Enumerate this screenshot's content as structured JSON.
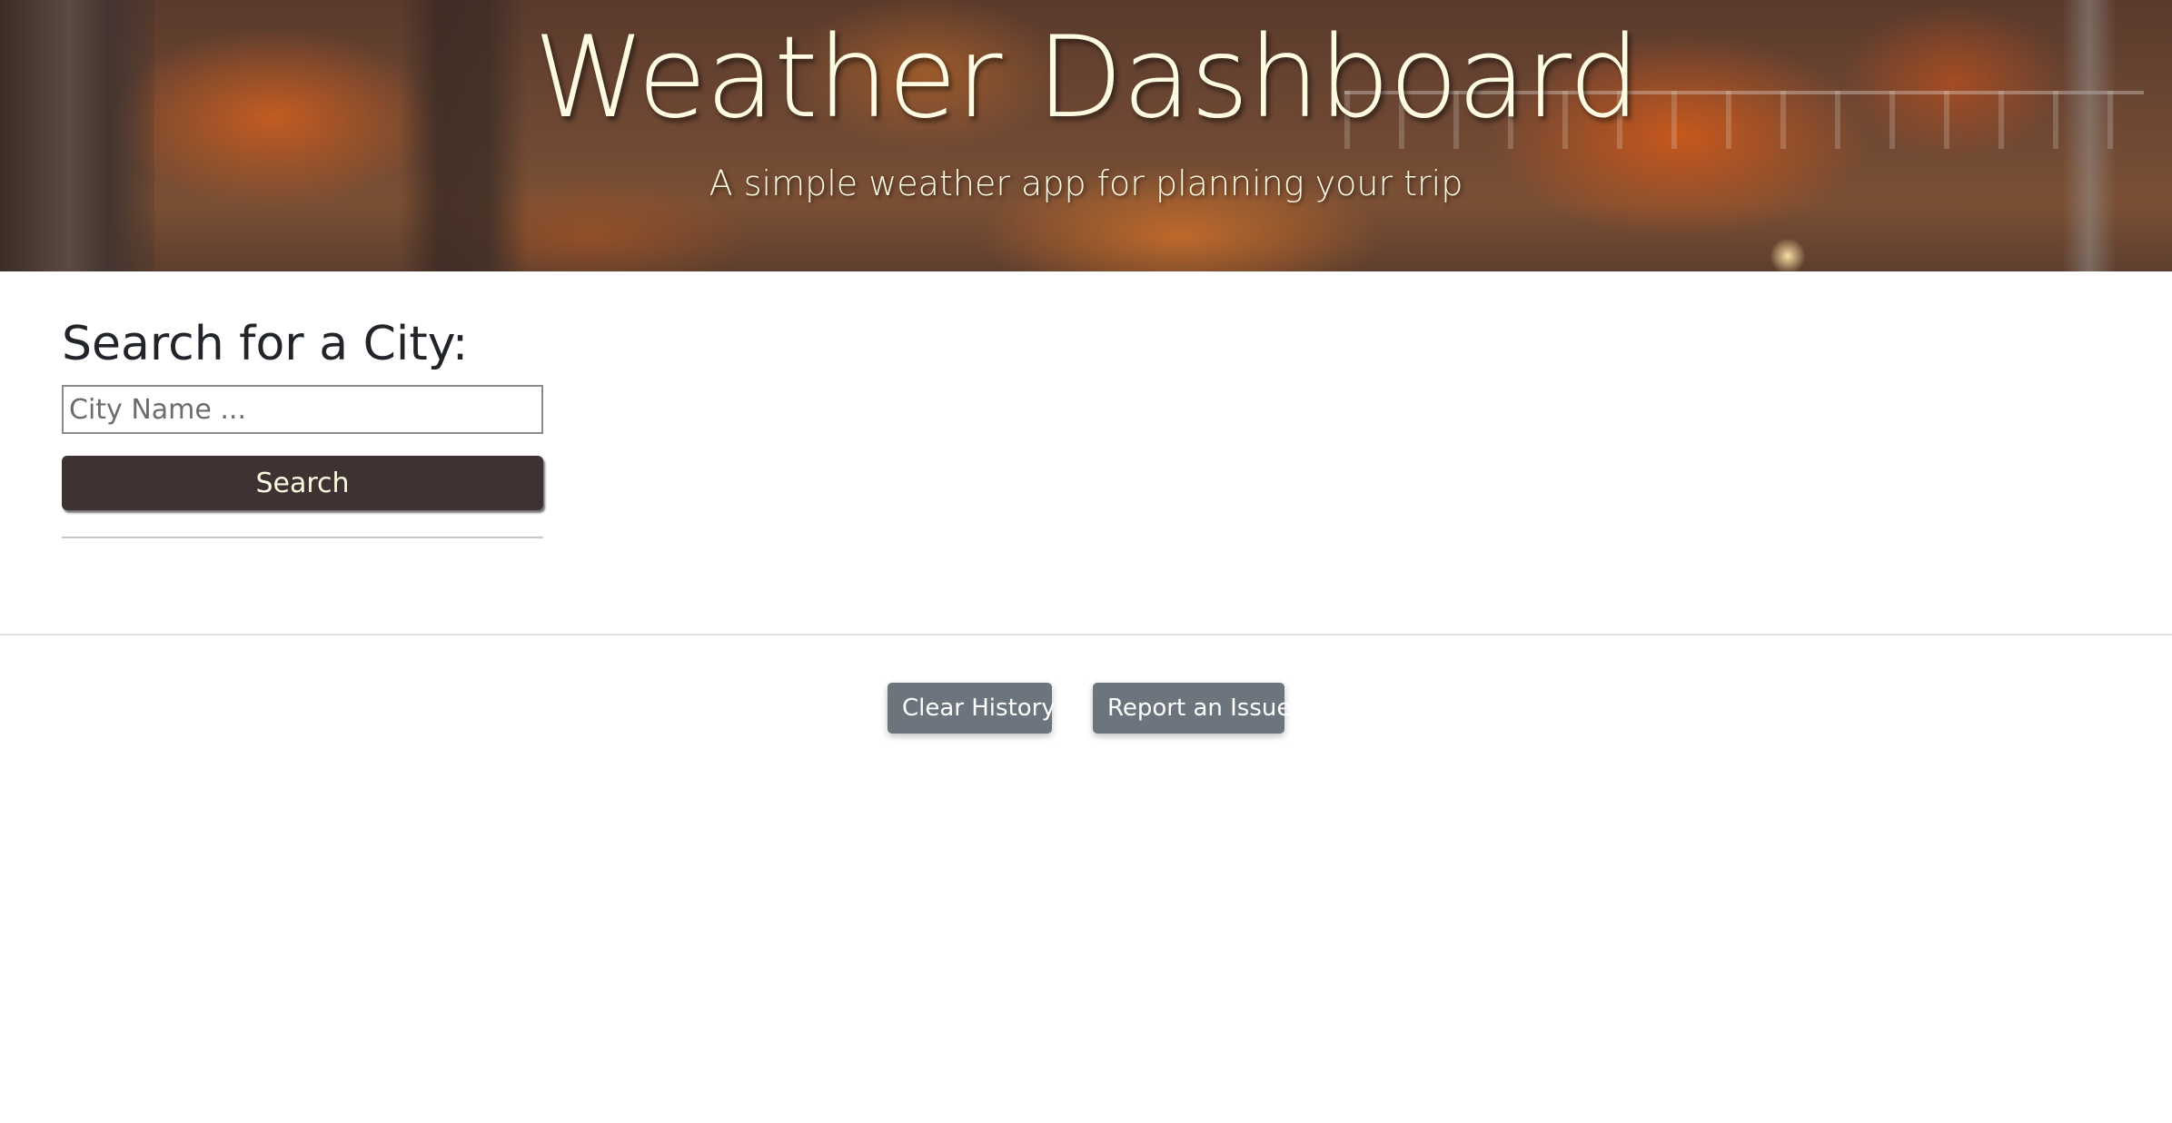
{
  "header": {
    "title": "Weather Dashboard",
    "subtitle": "A simple weather app for planning your trip"
  },
  "search": {
    "heading": "Search for a City:",
    "input_value": "",
    "input_placeholder": "City Name ...",
    "button_label": "Search"
  },
  "footer": {
    "clear_history_label": "Clear History",
    "report_issue_label": "Report an Issue"
  },
  "colors": {
    "title_text": "#fffbe3",
    "search_button_bg": "#3e3232",
    "footer_button_bg": "#6c757d"
  }
}
